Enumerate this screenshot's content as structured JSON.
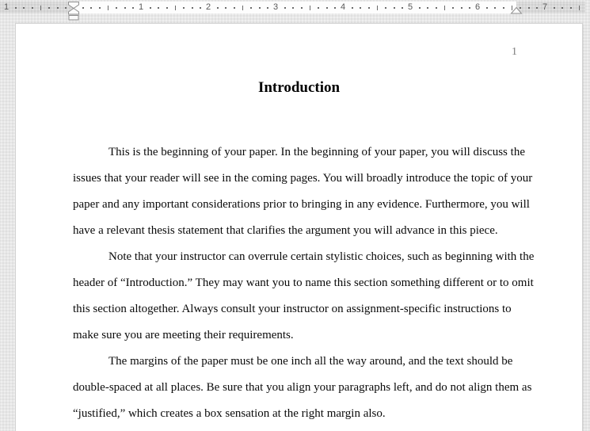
{
  "ruler": {
    "labels": [
      "1",
      "1",
      "2",
      "3",
      "4",
      "5",
      "6",
      "7"
    ],
    "markers": {
      "first_line_indent": "first-line-indent",
      "hanging_indent": "hanging-indent",
      "left_indent": "left-indent",
      "right_indent": "right-indent"
    }
  },
  "page": {
    "number": "1",
    "heading": "Introduction",
    "paragraphs": [
      {
        "lines": [
          "This is the beginning of your paper. In the beginning of your paper, you will discuss the",
          "issues that your reader will see in the coming pages. You will broadly introduce the topic of your",
          "paper and any important considerations prior to bringing in any evidence. Furthermore, you will",
          "have a relevant thesis statement that clarifies the argument you will advance in this piece."
        ]
      },
      {
        "lines": [
          "Note that your instructor can overrule certain stylistic choices, such as beginning with the",
          "header of “Introduction.” They may want you to name this section something different or to omit",
          "this section altogether. Always consult your instructor on assignment-specific instructions to",
          "make sure you are meeting their requirements."
        ]
      },
      {
        "lines": [
          "The margins of the paper must be one inch all the way around, and the text should be",
          "double-spaced at all places. Be sure that you align your paragraphs left, and do not align them as",
          "“justified,” which creates a box sensation at the right margin also."
        ]
      }
    ]
  },
  "colors": {
    "background": "#e7e7e7",
    "ruler_margin": "#d8d8d8",
    "ruler_active": "#fdfdfd",
    "page": "#ffffff",
    "page_number_text": "#7d7d7d",
    "body_text": "#0a0a0a"
  }
}
